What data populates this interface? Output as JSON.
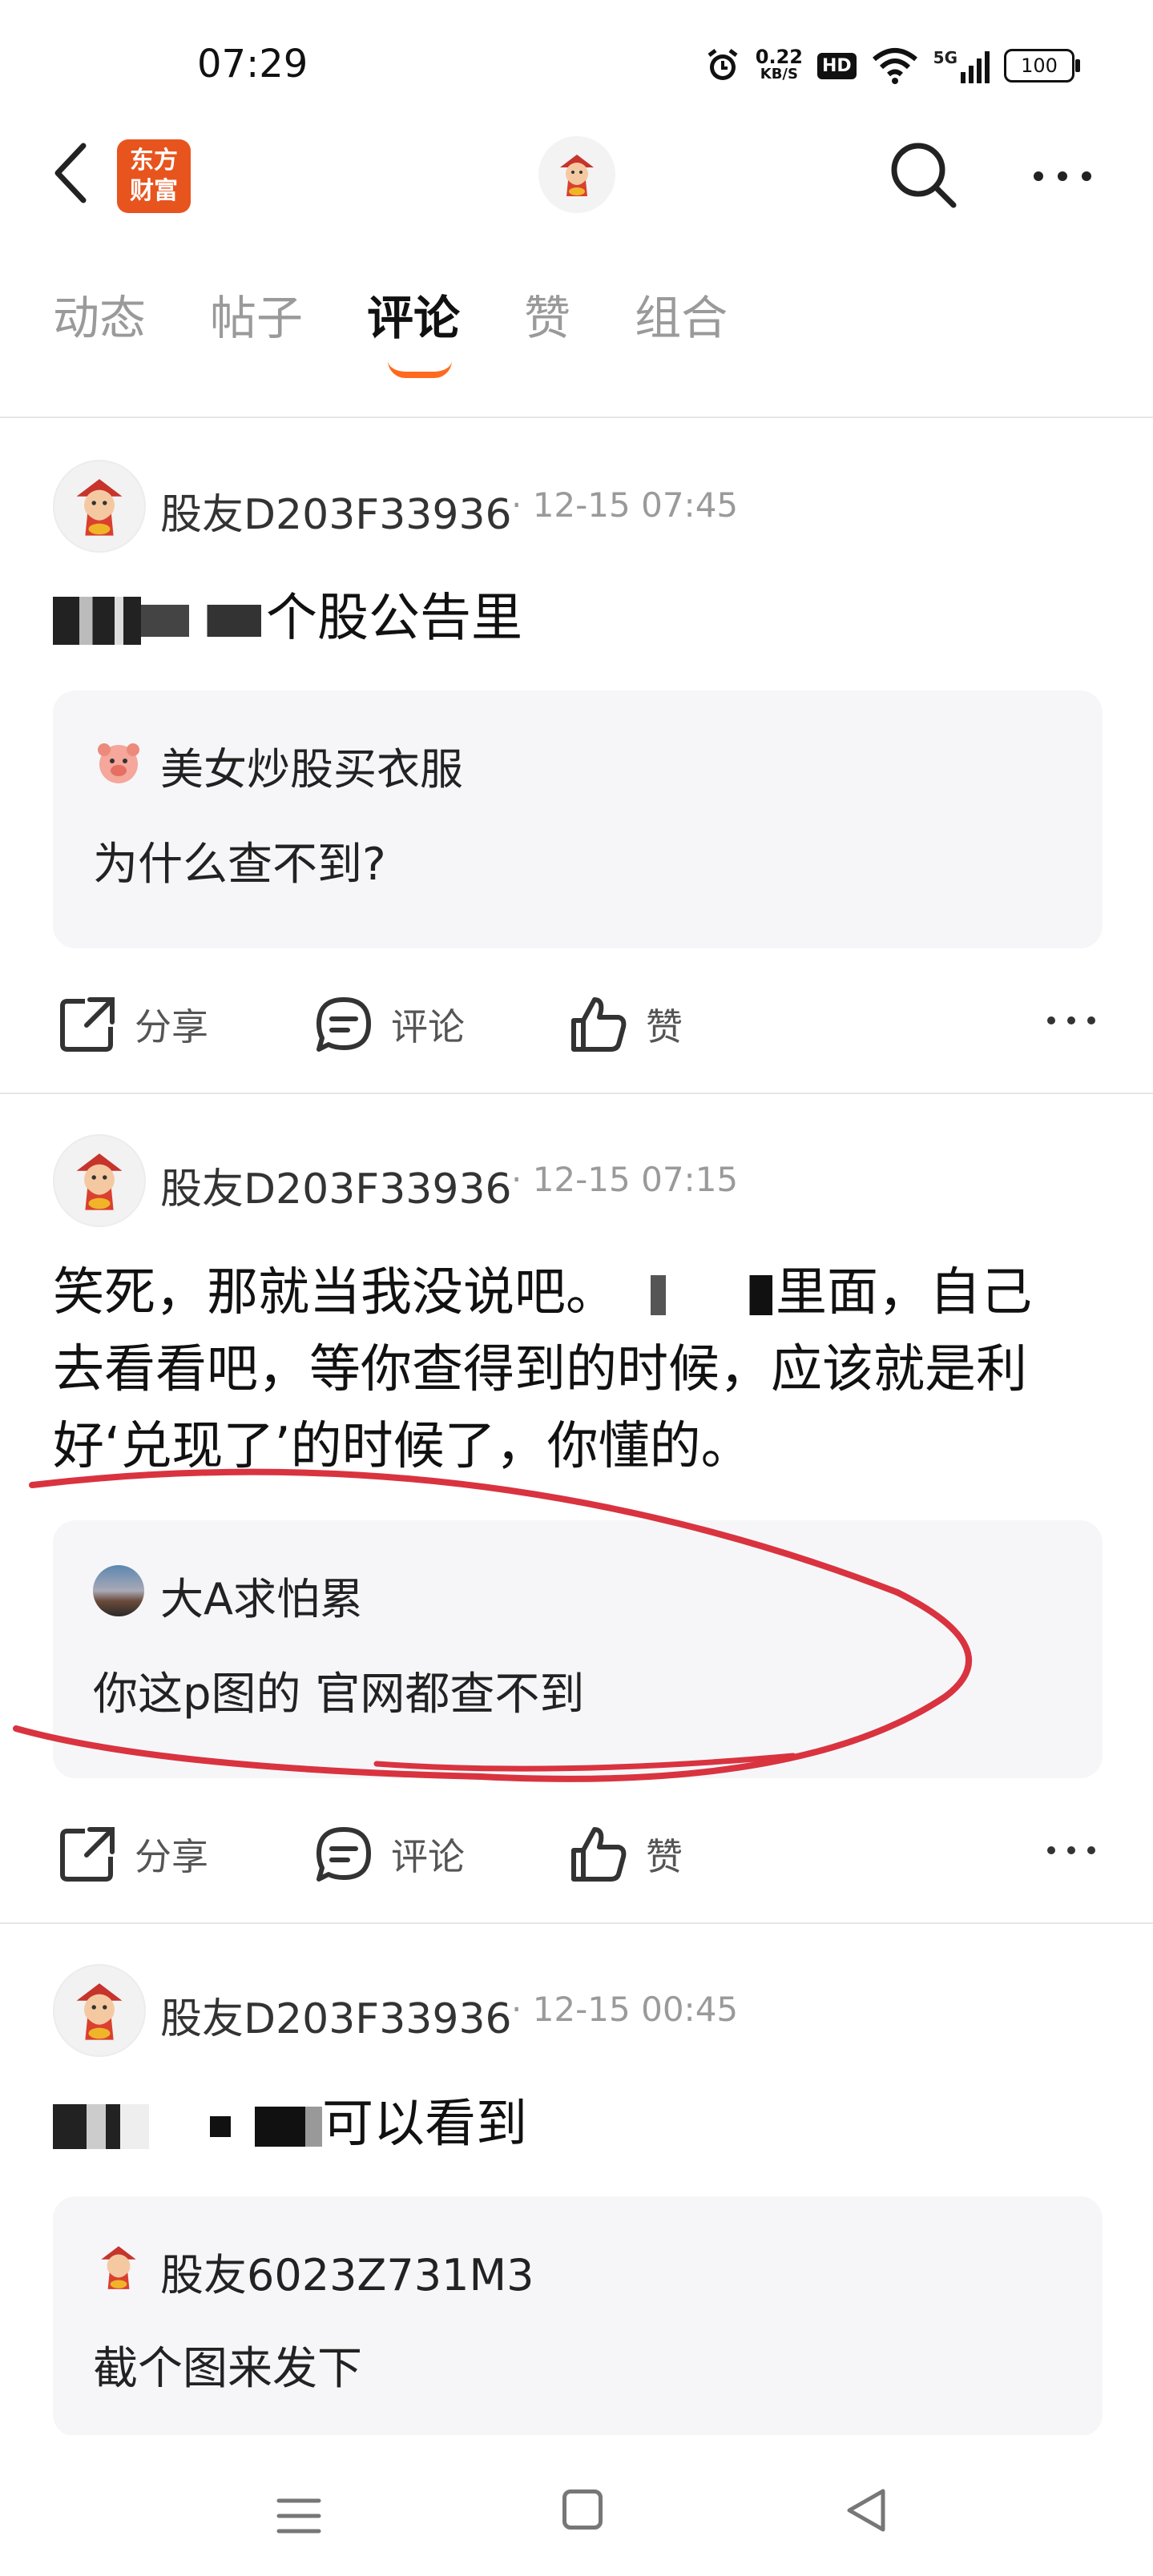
{
  "status_bar": {
    "time": "07:29",
    "net_speed_value": "0.22",
    "net_speed_unit": "KB/S",
    "hd": "HD",
    "network": "5G",
    "battery": "100"
  },
  "header": {
    "logo_line1": "东方",
    "logo_line2": "财富"
  },
  "tabs": [
    {
      "label": "动态"
    },
    {
      "label": "帖子"
    },
    {
      "label": "评论",
      "active": true
    },
    {
      "label": "赞"
    },
    {
      "label": "组合"
    }
  ],
  "posts": [
    {
      "author": "股友D203F33936",
      "time": "· 12-15 07:45",
      "content_tail": "个股公告里",
      "reply": {
        "name": "美女炒股买衣服",
        "text": "为什么查不到?"
      }
    },
    {
      "author": "股友D203F33936",
      "time": "· 12-15 07:15",
      "content_line1_a": "笑死，那就当我没说吧。",
      "content_line1_b": "里面，自己",
      "content_line2": "去看看吧，等你查得到的时候，应该就是利",
      "content_line3": "好‘兑现了’的时候了，你懂的。",
      "reply": {
        "name": "大A求怕累",
        "text": "你这p图的 官网都查不到"
      }
    },
    {
      "author": "股友D203F33936",
      "time": "· 12-15 00:45",
      "content_tail": "可以看到",
      "reply": {
        "name": "股友6023Z731M3",
        "text": "截个图来发下"
      }
    }
  ],
  "actions": {
    "share": "分享",
    "comment": "评论",
    "like": "赞"
  },
  "colors": {
    "accent": "#ff6a1f",
    "brand": "#e8541e",
    "annotation": "#d9333f"
  }
}
